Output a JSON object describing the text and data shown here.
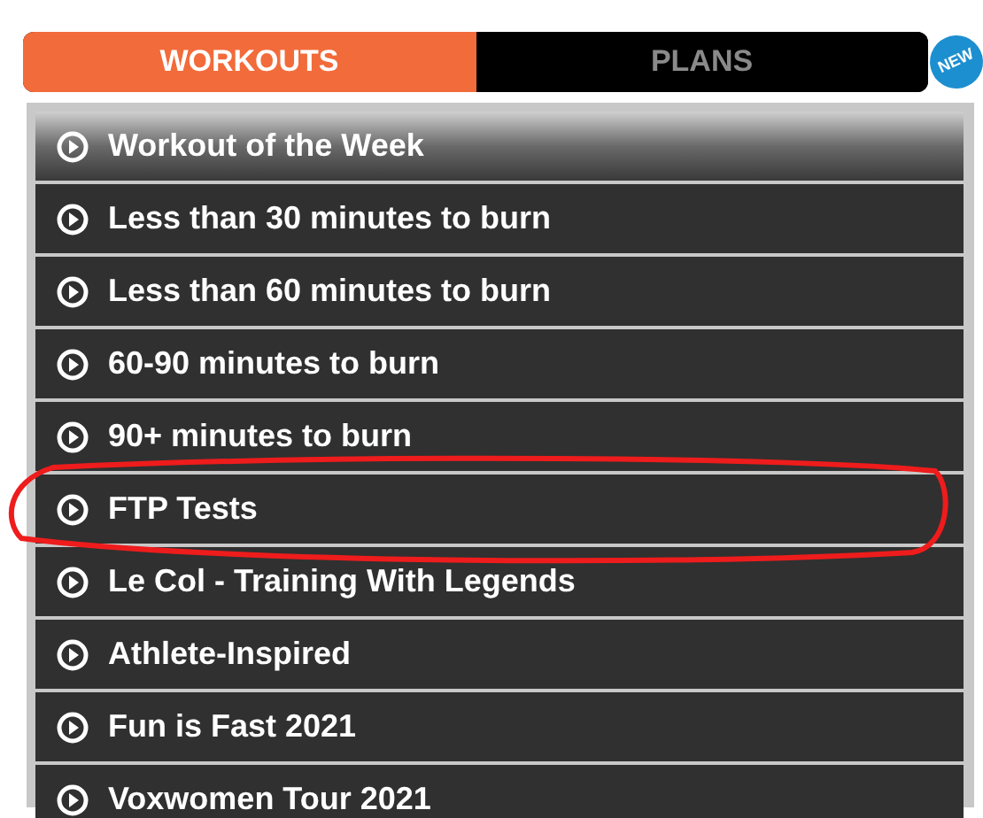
{
  "tabs": [
    {
      "label": "WORKOUTS",
      "selected": true
    },
    {
      "label": "PLANS",
      "selected": false,
      "badge": "NEW"
    }
  ],
  "categories": [
    {
      "label": "Workout of the Week",
      "selected": true,
      "highlighted": false
    },
    {
      "label": "Less than 30 minutes to burn",
      "selected": false,
      "highlighted": false
    },
    {
      "label": "Less than 60 minutes to burn",
      "selected": false,
      "highlighted": false
    },
    {
      "label": "60-90 minutes to burn",
      "selected": false,
      "highlighted": false
    },
    {
      "label": "90+ minutes to burn",
      "selected": false,
      "highlighted": false
    },
    {
      "label": "FTP Tests",
      "selected": false,
      "highlighted": true
    },
    {
      "label": "Le Col - Training With Legends",
      "selected": false,
      "highlighted": false
    },
    {
      "label": "Athlete-Inspired",
      "selected": false,
      "highlighted": false
    },
    {
      "label": "Fun is Fast 2021",
      "selected": false,
      "highlighted": false
    },
    {
      "label": "Voxwomen Tour 2021",
      "selected": false,
      "highlighted": false
    }
  ]
}
